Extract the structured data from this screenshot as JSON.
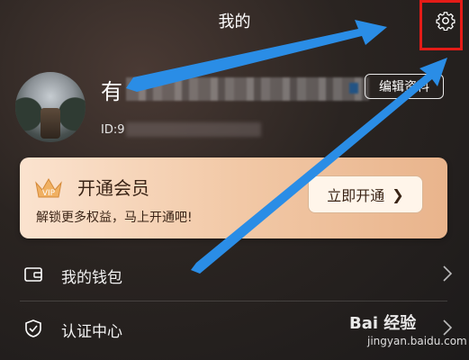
{
  "header": {
    "title": "我的",
    "settings_icon": "gear-icon"
  },
  "profile": {
    "name_visible": "有",
    "id_prefix": "ID:9",
    "edit_label": "编辑资料"
  },
  "vip": {
    "badge": "VIP",
    "title": "开通会员",
    "subtitle": "解锁更多权益，马上开通吧!",
    "button_label": "立即开通"
  },
  "menu": [
    {
      "label": "我的钱包",
      "icon": "wallet-icon"
    },
    {
      "label": "认证中心",
      "icon": "shield-check-icon"
    }
  ],
  "watermark": {
    "brand": "Bai 经验",
    "url": "jingyan.baidu.com"
  },
  "colors": {
    "highlight": "#e41b17",
    "arrow": "#2a8de6",
    "vip_text": "#3a2416"
  }
}
